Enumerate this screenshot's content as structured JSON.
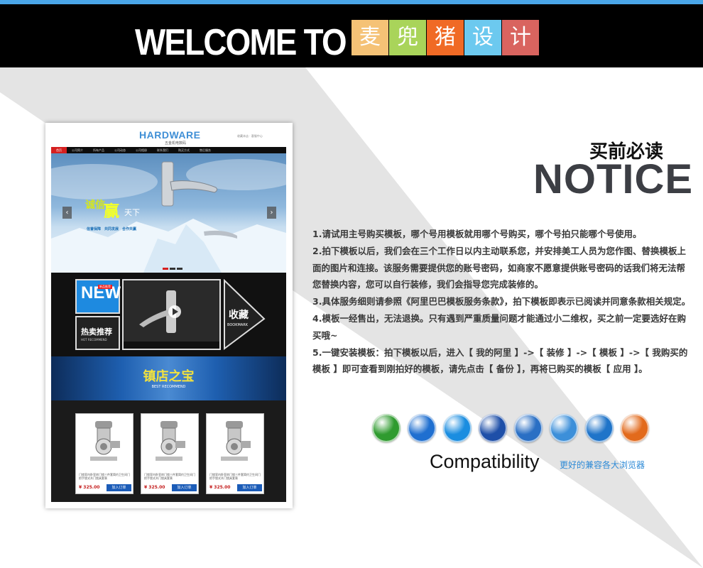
{
  "header": {
    "welcome": "WELCOME TO",
    "brand_tiles": [
      {
        "char": "麦",
        "color": "#f5c276"
      },
      {
        "char": "兜",
        "color": "#a9d45a"
      },
      {
        "char": "猪",
        "color": "#f06a25"
      },
      {
        "char": "设",
        "color": "#6cc9ef"
      },
      {
        "char": "计",
        "color": "#d9645f"
      }
    ]
  },
  "preview": {
    "logo": "HARDWARE",
    "logo_sub": "五金机电数码",
    "header_right": "收藏本店 · 客服中心",
    "nav": [
      "首页",
      "公司简介",
      "所有产品",
      "公司动态",
      "公司相册",
      "联系我们",
      "购买方式",
      "售后服务"
    ],
    "banner": {
      "slogan_a": "诚信",
      "slogan_b": "赢",
      "slogan_c": "天下",
      "slogan_sub": "信誉保障　共同发展　合作共赢",
      "prev": "‹",
      "next": "›"
    },
    "feature": {
      "new_label": "NEW",
      "new_badge": "新品推荐",
      "hot_label": "热卖推荐",
      "hot_sub": "HOT RECOMMEND",
      "bookmark_cn": "收藏",
      "bookmark_en": "BOOKMARK"
    },
    "best": {
      "title": "镇店之宝",
      "subtitle": "BEST RECOMMEND"
    },
    "products": [
      {
        "desc": "门锁室内卧室房门锁三件套简约卫生间门把手锁式木门锁具套装",
        "price": "¥ 325.00",
        "button": "加入订单"
      },
      {
        "desc": "门锁室内卧室房门锁三件套简约卫生间门把手锁式木门锁具套装",
        "price": "¥ 325.00",
        "button": "加入订单"
      },
      {
        "desc": "门锁室内卧室房门锁三件套简约卫生间门把手锁式木门锁具套装",
        "price": "¥ 325.00",
        "button": "加入订单"
      }
    ]
  },
  "notice": {
    "title_cn": "买前必读",
    "title_en": "NOTICE",
    "rules": [
      "1.请试用主号购买模板，哪个号用模板就用哪个号购买，哪个号拍只能哪个号使用。",
      "2.拍下模板以后，我们会在三个工作日以内主动联系您，并安排美工人员为您作图、替换模板上面的图片和连接。该服务需要提供您的账号密码，如商家不愿意提供账号密码的话我们将无法帮您替换内容，您可以自行装修，我们会指导您完成装修的。",
      "3.具体服务细则请参照《阿里巴巴模板服务条款》，拍下模板即表示已阅读并同意条款相关规定。",
      "4.模板一经售出，无法退换。只有遇到严重质量问题才能通过小二维权，买之前一定要选好在购买哦~",
      "5.一键安装模板：拍下模板以后，进入【 我的阿里 】->【 装修 】->【 模板 】->【 我购买的模板 】即可查看到刚拍好的模板，请先点击【 备份 】，再将已购买的模板【 应用 】。"
    ]
  },
  "compatibility": {
    "label": "Compatibility",
    "label_cn": "更好的兼容各大浏览器",
    "browsers": [
      {
        "name": "ie-green",
        "color": "#2f9b2f"
      },
      {
        "name": "internet-explorer",
        "color": "#1f6fd0"
      },
      {
        "name": "sogou",
        "color": "#1a8de0"
      },
      {
        "name": "firefox-blue",
        "color": "#1e4fa8"
      },
      {
        "name": "globe",
        "color": "#2a6fc4"
      },
      {
        "name": "safari",
        "color": "#3c8fd9"
      },
      {
        "name": "maxthon",
        "color": "#1f74c9"
      },
      {
        "name": "firefox",
        "color": "#e26a1c"
      }
    ]
  }
}
